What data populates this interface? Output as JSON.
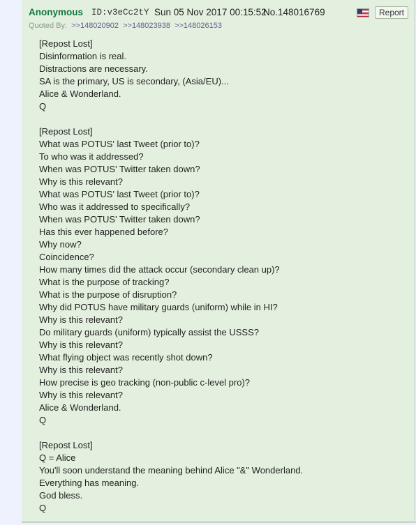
{
  "post": {
    "name": "Anonymous",
    "id_label": "ID:v3eCc2tY",
    "datetime": "Sun 05 Nov 2017 00:15:52",
    "number": "No.148016769",
    "report_label": "Report",
    "flag_icon": "us-flag-icon",
    "quoted_by_label": "Quoted By:",
    "quoted_by": [
      ">>148020902",
      ">>148023938",
      ">>148026153"
    ],
    "lines": [
      "[Repost Lost]",
      "Disinformation is real.",
      "Distractions are necessary.",
      "SA is the primary, US is secondary, (Asia/EU)...",
      "Alice & Wonderland.",
      "Q",
      "",
      "[Repost Lost]",
      "What was POTUS' last Tweet (prior to)?",
      "To who was it addressed?",
      "When was POTUS' Twitter taken down?",
      "Why is this relevant?",
      "What was POTUS' last Tweet (prior to)?",
      "Who was it addressed to specifically?",
      "When was POTUS' Twitter taken down?",
      "Has this ever happened before?",
      "Why now?",
      "Coincidence?",
      "How many times did the attack occur (secondary clean up)?",
      "What is the purpose of tracking?",
      "What is the purpose of disruption?",
      "Why did POTUS have military guards (uniform) while in HI?",
      "Why is this relevant?",
      "Do military guards (uniform) typically assist the USSS?",
      "Why is this relevant?",
      "What flying object was recently shot down?",
      "Why is this relevant?",
      "How precise is geo tracking (non-public c-level pro)?",
      "Why is this relevant?",
      "Alice & Wonderland.",
      "Q",
      "",
      "[Repost Lost]",
      "Q = Alice",
      "You'll soon understand the meaning behind Alice \"&\" Wonderland.",
      "Everything has meaning.",
      "God bless.",
      "Q"
    ]
  },
  "colors": {
    "name": "#117743",
    "post_bg": "#e4f0df",
    "page_bg": "#eef2ff",
    "quote_link": "#5e5e8f"
  }
}
